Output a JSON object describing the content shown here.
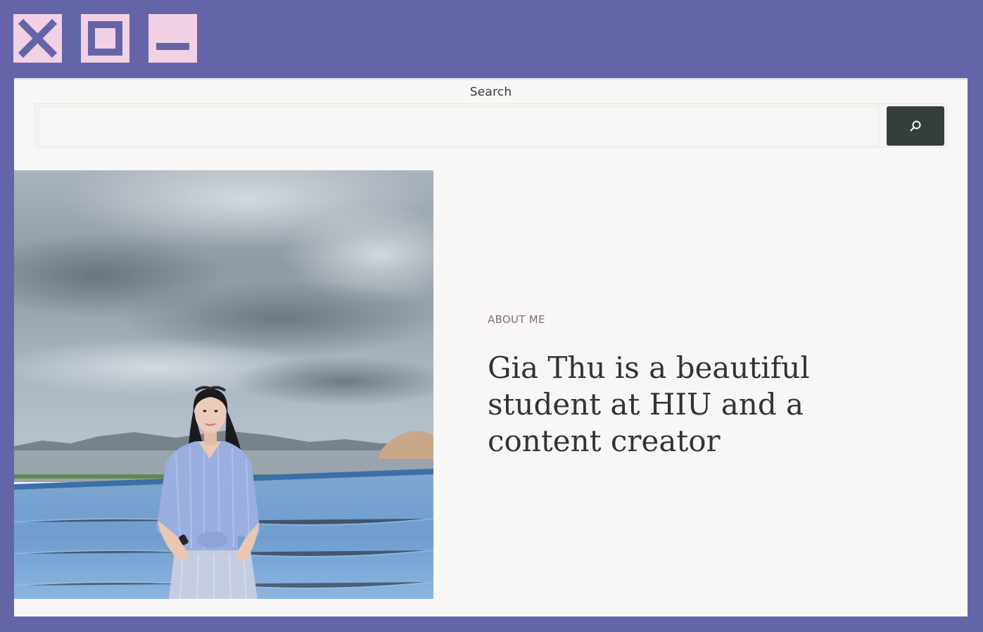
{
  "window_controls": {
    "close_icon": "close-icon",
    "maximize_icon": "maximize-icon",
    "minimize_icon": "minimize-icon",
    "frame_color": "#6465a8",
    "button_color": "#f3d1e4"
  },
  "search": {
    "label": "Search",
    "value": "",
    "placeholder": "",
    "button_icon": "search-icon",
    "button_color": "#363d3d"
  },
  "about": {
    "kicker": "ABOUT ME",
    "heading": "Gia Thu is a beautiful student at HIU and a content creator"
  }
}
